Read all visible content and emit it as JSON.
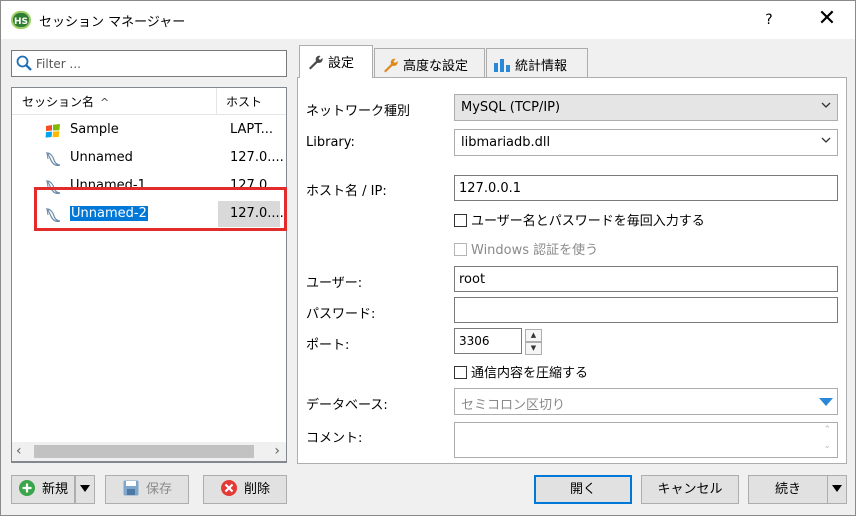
{
  "window": {
    "title": "セッション マネージャー",
    "help": "?",
    "close": "✕",
    "app_icon_text": "HS"
  },
  "filter": {
    "placeholder": "Filter ..."
  },
  "sessions": {
    "columns": {
      "name": "セッション名",
      "sort_indicator": "^",
      "host": "ホスト"
    },
    "rows": [
      {
        "name": "Sample",
        "host": "LAPT...",
        "icon": "windows-logo-icon",
        "selected": false
      },
      {
        "name": "Unnamed",
        "host": "127.0....",
        "icon": "mariadb-seal-icon",
        "selected": false
      },
      {
        "name": "Unnamed-1",
        "host": "127.0....",
        "icon": "mariadb-seal-icon",
        "selected": false
      },
      {
        "name": "Unnamed-2",
        "host": "127.0....",
        "icon": "mariadb-seal-icon",
        "selected": true
      }
    ],
    "highlight_color": "#e32b2b"
  },
  "tabs": [
    {
      "label": "設定",
      "icon": "wrench-icon",
      "active": true
    },
    {
      "label": "高度な設定",
      "icon": "wrench-orange-icon",
      "active": false
    },
    {
      "label": "統計情報",
      "icon": "bar-chart-icon",
      "active": false
    }
  ],
  "settings": {
    "network_type": {
      "label": "ネットワーク種別",
      "value": "MySQL (TCP/IP)"
    },
    "library": {
      "label": "Library:",
      "value": "libmariadb.dll"
    },
    "host": {
      "label": "ホスト名 / IP:",
      "value": "127.0.0.1"
    },
    "prompt_login": {
      "label": "ユーザー名とパスワードを毎回入力する",
      "checked": false
    },
    "windows_auth": {
      "label": "Windows 認証を使う",
      "checked": false,
      "disabled": true
    },
    "user": {
      "label": "ユーザー:",
      "value": "root"
    },
    "password": {
      "label": "パスワード:",
      "value": ""
    },
    "port": {
      "label": "ポート:",
      "value": "3306"
    },
    "compress": {
      "label": "通信内容を圧縮する",
      "checked": false
    },
    "databases": {
      "label": "データベース:",
      "placeholder": "セミコロン区切り"
    },
    "comment": {
      "label": "コメント:",
      "value": ""
    }
  },
  "buttons": {
    "new": "新規",
    "save": "保存",
    "delete": "削除",
    "open": "開く",
    "cancel": "キャンセル",
    "more": "続き"
  },
  "colors": {
    "accent": "#0078d7",
    "selection": "#0078d7"
  }
}
